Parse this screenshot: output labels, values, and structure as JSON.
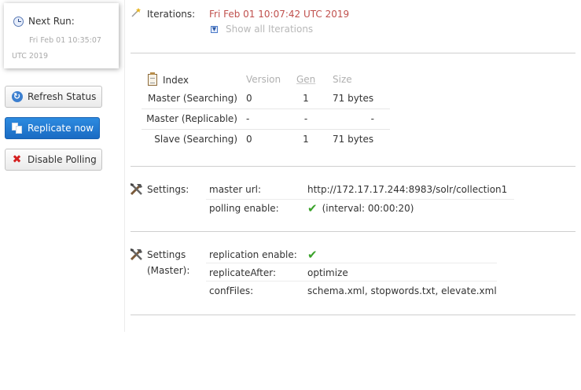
{
  "timer": {
    "title": "Next Run:",
    "value": "Fri Feb 01 10:35:07 UTC 2019"
  },
  "buttons": {
    "refresh": "Refresh Status",
    "replicate": "Replicate now",
    "disable": "Disable Polling"
  },
  "iterations": {
    "label": "Iterations:",
    "value": "Fri Feb 01 10:07:42 UTC 2019",
    "show_all": "Show all Iterations"
  },
  "index_table": {
    "headers": {
      "name": "Index",
      "version": "Version",
      "gen": "Gen",
      "size": "Size"
    },
    "rows": [
      {
        "name": "Master (Searching)",
        "version": "0",
        "gen": "1",
        "size": "71 bytes"
      },
      {
        "name": "Master (Replicable)",
        "version": "-",
        "gen": "-",
        "size": "-"
      },
      {
        "name": "Slave (Searching)",
        "version": "0",
        "gen": "1",
        "size": "71 bytes"
      }
    ]
  },
  "settings": {
    "label": "Settings:",
    "master_url_key": "master url:",
    "master_url_value": "http://172.17.17.244:8983/solr/collection1",
    "polling_key": "polling enable:",
    "polling_value": "(interval: 00:00:20)"
  },
  "master_settings": {
    "label_line1": "Settings",
    "label_line2": "(Master):",
    "replication_key": "replication enable:",
    "replicate_after_key": "replicateAfter:",
    "replicate_after_value": "optimize",
    "conf_files_key": "confFiles:",
    "conf_files_value": "schema.xml, stopwords.txt, elevate.xml"
  },
  "colors": {
    "accent": "#1a6bc3",
    "iteration_date": "#c0504d",
    "check": "#3aa22a",
    "disable": "#d42020"
  }
}
